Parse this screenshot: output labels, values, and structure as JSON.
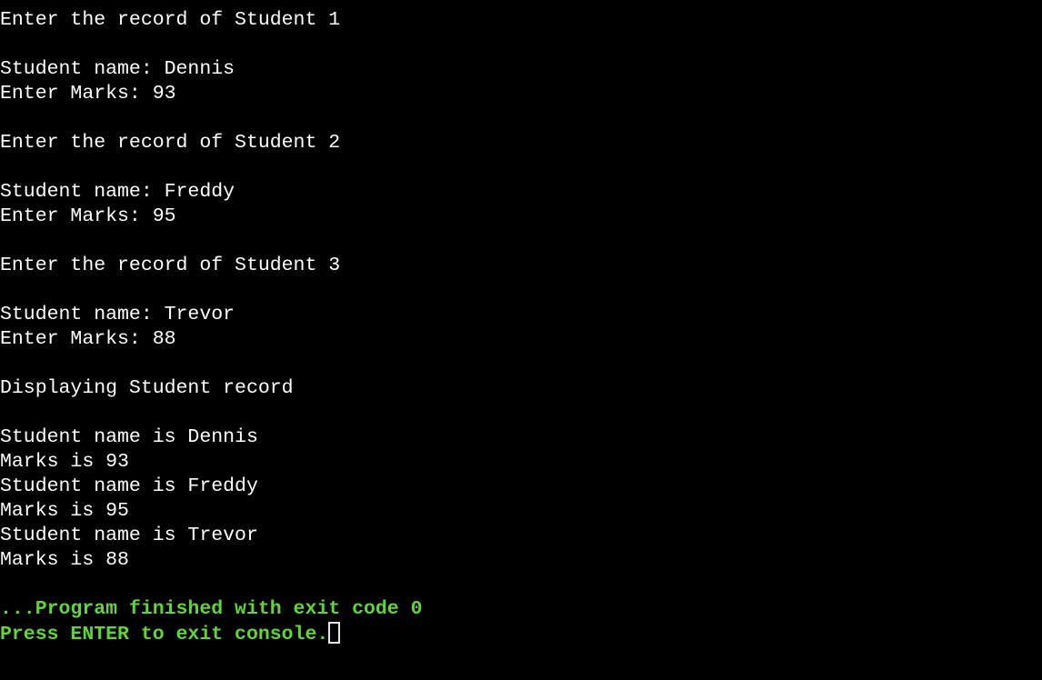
{
  "console": {
    "background_color": "#000000",
    "text_color": "#ffffff",
    "status_color": "#62d338",
    "cursor_color": "#e6e6e6",
    "lines": [
      {
        "text": "Enter the record of Student 1",
        "style": "output"
      },
      {
        "text": "",
        "style": "blank"
      },
      {
        "text": "Student name: Dennis",
        "style": "output"
      },
      {
        "text": "Enter Marks: 93",
        "style": "output"
      },
      {
        "text": "",
        "style": "blank"
      },
      {
        "text": "Enter the record of Student 2",
        "style": "output"
      },
      {
        "text": "",
        "style": "blank"
      },
      {
        "text": "Student name: Freddy",
        "style": "output"
      },
      {
        "text": "Enter Marks: 95",
        "style": "output"
      },
      {
        "text": "",
        "style": "blank"
      },
      {
        "text": "Enter the record of Student 3",
        "style": "output"
      },
      {
        "text": "",
        "style": "blank"
      },
      {
        "text": "Student name: Trevor",
        "style": "output"
      },
      {
        "text": "Enter Marks: 88",
        "style": "output"
      },
      {
        "text": "",
        "style": "blank"
      },
      {
        "text": "Displaying Student record",
        "style": "output"
      },
      {
        "text": "",
        "style": "blank"
      },
      {
        "text": "Student name is Dennis",
        "style": "output"
      },
      {
        "text": "Marks is 93",
        "style": "output"
      },
      {
        "text": "Student name is Freddy",
        "style": "output"
      },
      {
        "text": "Marks is 95",
        "style": "output"
      },
      {
        "text": "Student name is Trevor",
        "style": "output"
      },
      {
        "text": "Marks is 88",
        "style": "output"
      },
      {
        "text": "",
        "style": "blank"
      },
      {
        "text": "...Program finished with exit code 0",
        "style": "status"
      },
      {
        "text": "Press ENTER to exit console.",
        "style": "status",
        "cursor": true
      }
    ],
    "records": {
      "entry_prompts": [
        {
          "header": "Enter the record of Student 1",
          "name_prompt": "Student name: Dennis",
          "marks_prompt": "Enter Marks: 93",
          "student_index": 1,
          "name": "Dennis",
          "marks": 93
        },
        {
          "header": "Enter the record of Student 2",
          "name_prompt": "Student name: Freddy",
          "marks_prompt": "Enter Marks: 95",
          "student_index": 2,
          "name": "Freddy",
          "marks": 95
        },
        {
          "header": "Enter the record of Student 3",
          "name_prompt": "Student name: Trevor",
          "marks_prompt": "Enter Marks: 88",
          "student_index": 3,
          "name": "Trevor",
          "marks": 88
        }
      ],
      "display_header": "Displaying Student record",
      "display_rows": [
        {
          "name_line": "Student name is Dennis",
          "marks_line": "Marks is 93"
        },
        {
          "name_line": "Student name is Freddy",
          "marks_line": "Marks is 95"
        },
        {
          "name_line": "Student name is Trevor",
          "marks_line": "Marks is 88"
        }
      ]
    },
    "footer": {
      "exit_message": "...Program finished with exit code 0",
      "exit_code": 0,
      "prompt_message": "Press ENTER to exit console."
    }
  }
}
